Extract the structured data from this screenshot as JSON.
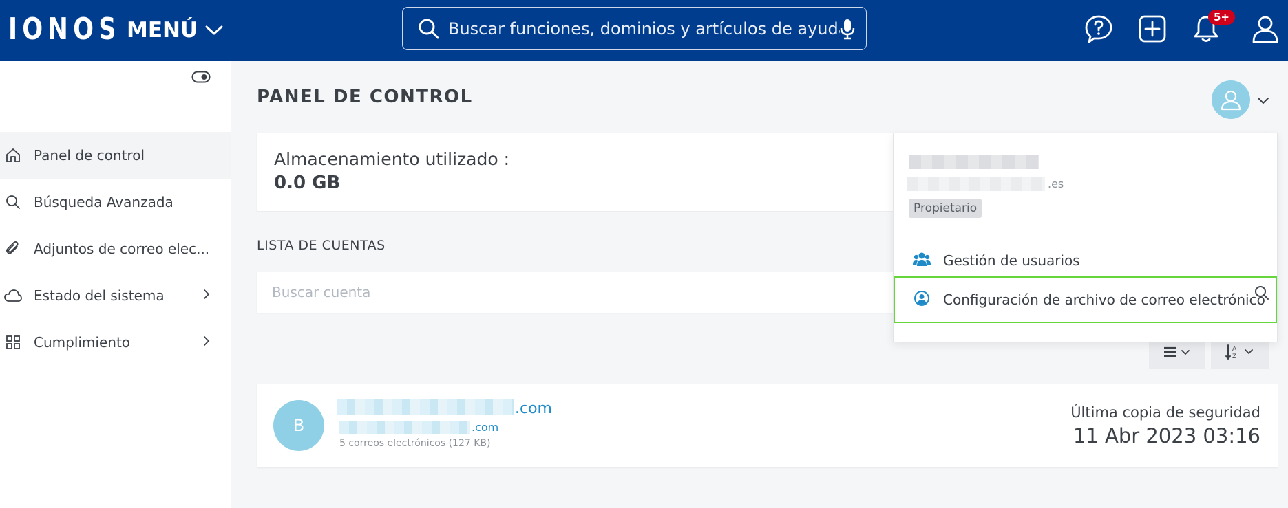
{
  "header": {
    "logo": "IONOS",
    "menu_label": "MENÚ",
    "search_placeholder": "Buscar funciones, dominios y artículos de ayuda",
    "notifications_badge": "5+"
  },
  "sidebar": {
    "items": [
      {
        "label": "Panel de control",
        "icon": "home-icon",
        "active": true
      },
      {
        "label": "Búsqueda Avanzada",
        "icon": "search-icon"
      },
      {
        "label": "Adjuntos de correo elec...",
        "icon": "paperclip-icon"
      },
      {
        "label": "Estado del sistema",
        "icon": "cloud-icon",
        "has_submenu": true
      },
      {
        "label": "Cumplimiento",
        "icon": "grid-icon",
        "has_submenu": true
      }
    ]
  },
  "main": {
    "title": "PANEL DE CONTROL",
    "storage_label": "Almacenamiento utilizado :",
    "storage_value": "0.0 GB",
    "list_heading": "LISTA DE CUENTAS",
    "search_account_placeholder": "Buscar cuenta",
    "account": {
      "initial": "B",
      "email_tld": ".com",
      "alias_tld": ".com",
      "meta": "5 correos electrónicos (127 KB)",
      "backup_label": "Última copia de seguridad",
      "backup_date": "11 Abr 2023 03:16"
    }
  },
  "user_dropdown": {
    "email_tld": ".es",
    "role": "Propietario",
    "items": [
      {
        "label": "Gestión de usuarios",
        "icon": "users-icon"
      },
      {
        "label": "Configuración de archivo de correo electrónico",
        "icon": "user-circle-icon",
        "highlighted": true
      }
    ]
  },
  "colors": {
    "header_bg": "#003d8f",
    "accent": "#1e8bc8",
    "avatar": "#8fd0e6",
    "highlight": "#66d63c",
    "badge": "#d0021b"
  }
}
